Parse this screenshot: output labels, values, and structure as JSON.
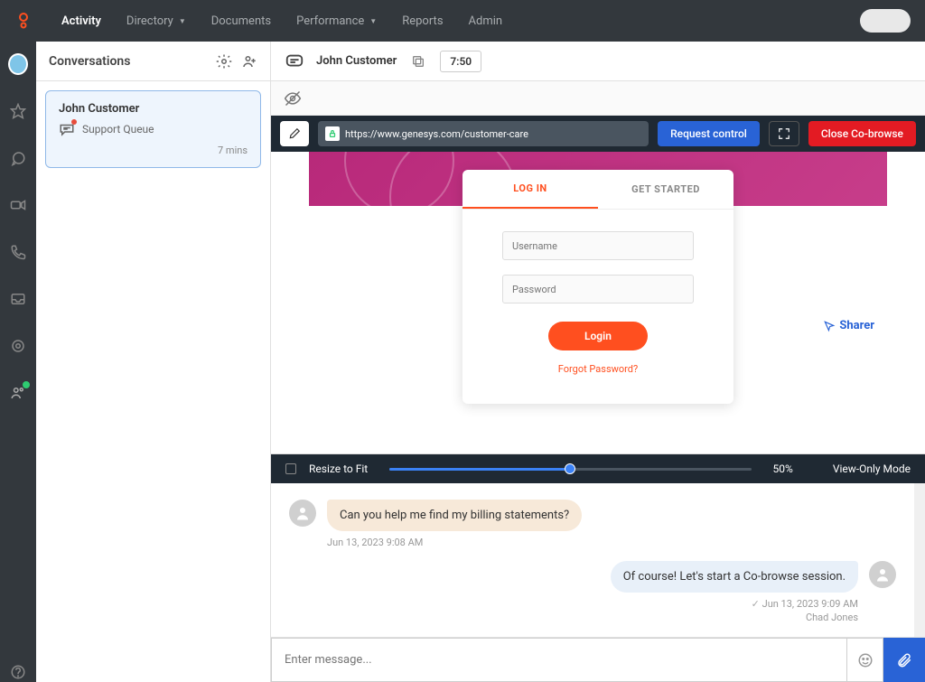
{
  "nav": {
    "items": [
      "Activity",
      "Directory",
      "Documents",
      "Performance",
      "Reports",
      "Admin"
    ],
    "active": 0,
    "dropdowns": [
      1,
      3
    ]
  },
  "conversations": {
    "title": "Conversations",
    "items": [
      {
        "name": "John Customer",
        "queue": "Support Queue",
        "time": "7 mins"
      }
    ]
  },
  "customer_header": {
    "name": "John Customer",
    "timer": "7:50"
  },
  "cobrowse": {
    "url": "https://www.genesys.com/customer-care",
    "request_btn": "Request control",
    "close_btn": "Close Co-browse"
  },
  "login_page": {
    "tabs": [
      "LOG IN",
      "GET STARTED"
    ],
    "username_ph": "Username",
    "password_ph": "Password",
    "login_btn": "Login",
    "forgot": "Forgot Password?",
    "sharer": "Sharer"
  },
  "zoom": {
    "resize_label": "Resize to Fit",
    "percent": "50%",
    "mode": "View-Only Mode"
  },
  "chat": {
    "messages": [
      {
        "from": "customer",
        "text": "Can you help me find my billing statements?",
        "time": "Jun 13, 2023 9:08 AM"
      },
      {
        "from": "agent",
        "text": "Of course! Let's start a Co-browse session.",
        "time": "Jun 13, 2023 9:09 AM",
        "name": "Chad Jones"
      }
    ],
    "input_placeholder": "Enter message..."
  }
}
